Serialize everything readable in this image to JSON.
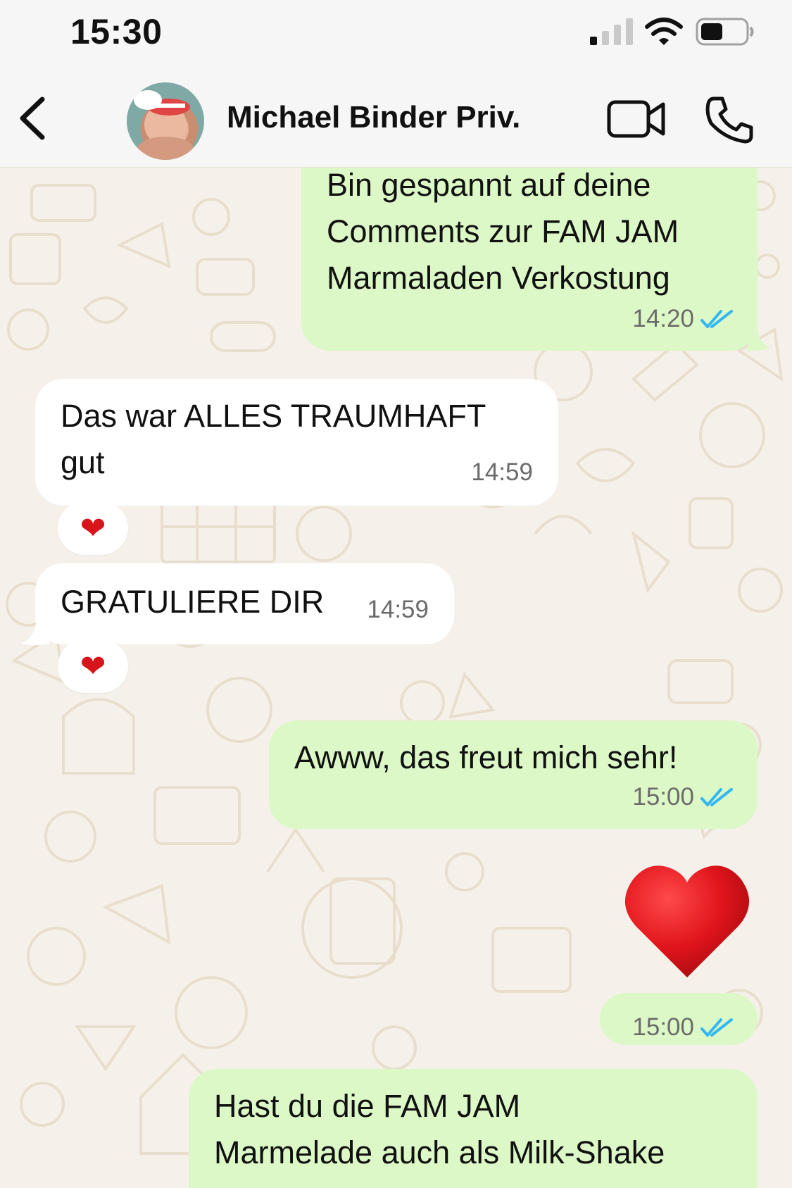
{
  "status_bar": {
    "time": "15:30",
    "battery_level": 0.5
  },
  "header": {
    "contact_name": "Michael Binder Priv.",
    "icons": [
      "back-chevron-icon",
      "avatar",
      "video-camera-icon",
      "phone-icon"
    ]
  },
  "colors": {
    "outgoing_bubble": "#dcf8c6",
    "incoming_bubble": "#ffffff",
    "read_ticks": "#34b7f1",
    "heart": "#d8141b",
    "wallpaper": "#f5f1ea"
  },
  "messages": [
    {
      "direction": "outgoing",
      "lines": [
        "Bin gespannt auf deine",
        "Comments zur FAM JAM",
        "Marmaladen Verkostung"
      ],
      "time": "14:20",
      "status": "read"
    },
    {
      "direction": "incoming",
      "lines": [
        "Das war ALLES TRAUMHAFT",
        "gut"
      ],
      "time": "14:59",
      "reaction": "❤"
    },
    {
      "direction": "incoming",
      "lines": [
        "GRATULIERE DIR"
      ],
      "time": "14:59",
      "reaction": "❤"
    },
    {
      "direction": "outgoing",
      "lines": [
        "Awww, das freut mich sehr!"
      ],
      "time": "15:00",
      "status": "read"
    },
    {
      "direction": "outgoing",
      "emoji": "heart",
      "time": "15:00",
      "status": "read"
    },
    {
      "direction": "outgoing",
      "lines": [
        "Hast du die FAM JAM",
        "Marmelade auch als Milk-Shake"
      ],
      "status": "read"
    }
  ]
}
